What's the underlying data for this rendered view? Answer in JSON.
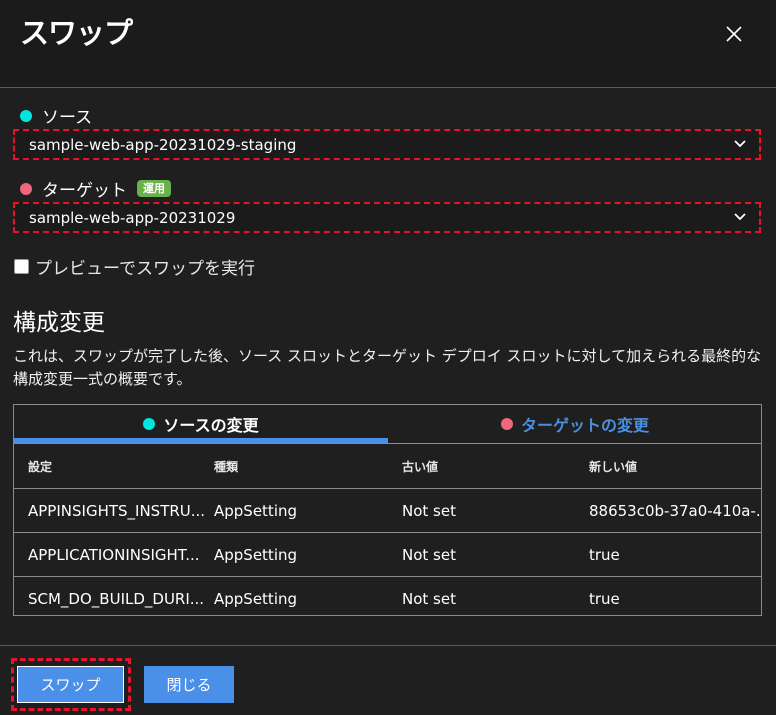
{
  "dialog": {
    "title": "スワップ"
  },
  "source": {
    "label": "ソース",
    "dot_color": "#00e5e0",
    "selected": "sample-web-app-20231029-staging"
  },
  "target": {
    "label": "ターゲット",
    "badge": "運用",
    "dot_color": "#f0667a",
    "selected": "sample-web-app-20231029"
  },
  "preview": {
    "label": "プレビューでスワップを実行",
    "checked": false
  },
  "config": {
    "title": "構成変更",
    "description": "これは、スワップが完了した後、ソース スロットとターゲット デプロイ スロットに対して加えられる最終的な構成変更一式の概要です。",
    "tabs": [
      {
        "label": "ソースの変更",
        "dot_color": "#00e5e0",
        "active": true
      },
      {
        "label": "ターゲットの変更",
        "dot_color": "#f0667a",
        "active": false
      }
    ],
    "columns": [
      "設定",
      "種類",
      "古い値",
      "新しい値"
    ],
    "rows": [
      [
        "APPINSIGHTS_INSTRU...",
        "AppSetting",
        "Not set",
        "88653c0b-37a0-410a-..."
      ],
      [
        "APPLICATIONINSIGHT...",
        "AppSetting",
        "Not set",
        "true"
      ],
      [
        "SCM_DO_BUILD_DURI...",
        "AppSetting",
        "Not set",
        "true"
      ]
    ]
  },
  "buttons": {
    "swap": "スワップ",
    "close": "閉じる"
  },
  "colors": {
    "accent": "#4a8fe8",
    "highlight": "#e8132a",
    "badge": "#6ab04c"
  }
}
